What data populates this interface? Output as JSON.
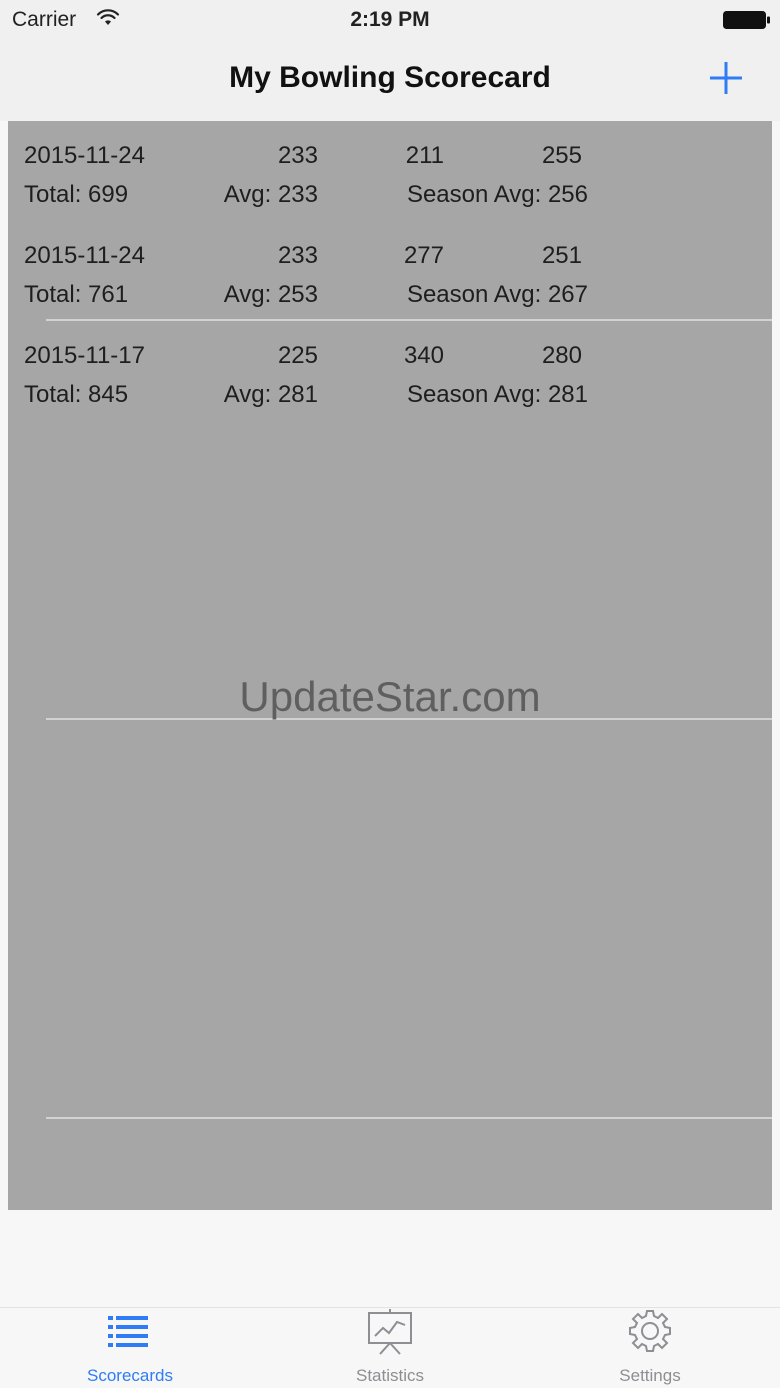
{
  "status_bar": {
    "carrier": "Carrier",
    "time": "2:19 PM"
  },
  "nav": {
    "title": "My Bowling Scorecard",
    "add_icon": "plus-icon"
  },
  "scorecards": [
    {
      "date": "2015-11-24",
      "games": [
        "233",
        "211",
        "255"
      ],
      "total": "Total: 699",
      "avg": "Avg: 233",
      "season_avg": "Season Avg: 256"
    },
    {
      "date": "2015-11-24",
      "games": [
        "233",
        "277",
        "251"
      ],
      "total": "Total: 761",
      "avg": "Avg: 253",
      "season_avg": "Season Avg: 267"
    },
    {
      "date": "2015-11-17",
      "games": [
        "225",
        "340",
        "280"
      ],
      "total": "Total: 845",
      "avg": "Avg: 281",
      "season_avg": "Season Avg: 281"
    }
  ],
  "watermark": "UpdateStar.com",
  "tabs": [
    {
      "label": "Scorecards",
      "icon": "list-icon",
      "active": true
    },
    {
      "label": "Statistics",
      "icon": "chart-board-icon",
      "active": false
    },
    {
      "label": "Settings",
      "icon": "gear-icon",
      "active": false
    }
  ],
  "colors": {
    "accent": "#2f7cf6",
    "content_bg": "#a6a6a6",
    "bar_bg": "#f0f0f0",
    "inactive_tab": "#8e8e93"
  }
}
